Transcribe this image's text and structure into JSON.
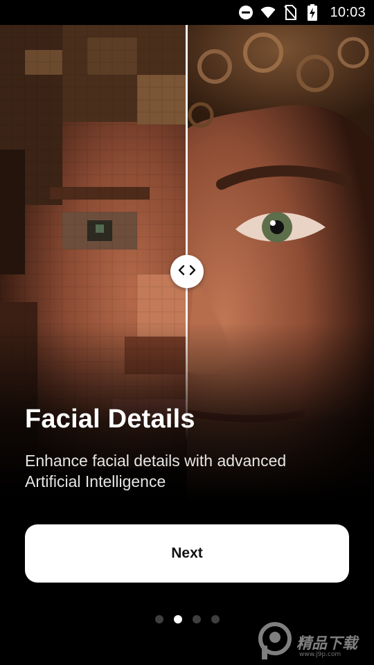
{
  "status_bar": {
    "time": "10:03",
    "icons": [
      "do-not-disturb-icon",
      "wifi-icon",
      "no-sim-icon",
      "battery-charging-icon"
    ]
  },
  "hero": {
    "left_label": "pixelated-face",
    "right_label": "enhanced-face",
    "handle_icon": "compare-arrows-icon",
    "split_fraction": 0.5
  },
  "onboarding": {
    "title": "Facial Details",
    "subtitle": "Enhance facial details with advanced Artificial Intelligence",
    "next_label": "Next"
  },
  "pagination": {
    "total": 4,
    "current": 2
  },
  "watermark": {
    "text": "精品下载",
    "sub": "www.j9p.com"
  },
  "colors": {
    "background": "#000000",
    "button_bg": "#ffffff",
    "button_text": "#111111",
    "dot_inactive": "#3f3f3f",
    "dot_active": "#ffffff"
  }
}
